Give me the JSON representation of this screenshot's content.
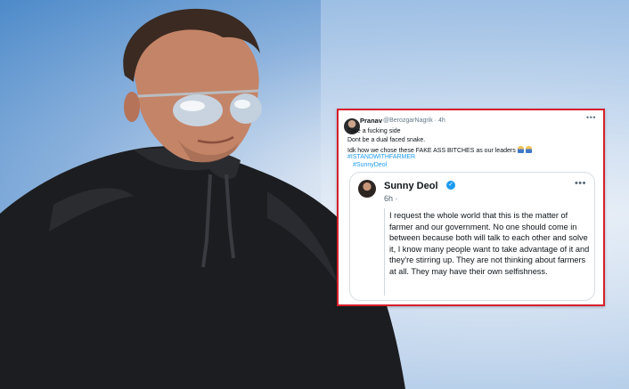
{
  "tweet": {
    "author_name": "Pranav",
    "author_meta": "@BerozgarNagrik · 4h",
    "more_icon": "more-horizontal-icon",
    "lines": [
      "Take a fucking side",
      "Dont be a dual faced snake.",
      "Idk how we chose these FAKE ASS BITCHES as our leaders"
    ],
    "hashtags": [
      "#ISTANDWITHFARMER",
      "#SunnyDeol"
    ]
  },
  "quoted_tweet": {
    "author_name": "Sunny  Deol",
    "timestamp": "6h ·",
    "verified_icon": "verified-badge-icon",
    "more_icon": "more-horizontal-icon",
    "body": "I request the whole world that this is the matter of farmer and our government. No one should come in between because both will talk to each other and solve it, I know many people want to take advantage of it and they're stirring up. They are not thinking about farmers at all. They may have their own selfishness."
  },
  "colors": {
    "frame_border": "#d61f2b",
    "hashtag_blue": "#1d9bf0",
    "sky_blue": "#4d8ac9"
  }
}
